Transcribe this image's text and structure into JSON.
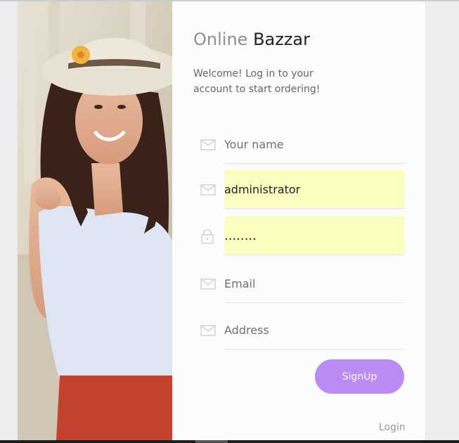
{
  "brand": {
    "part1": "Online",
    "part2": "Bazzar"
  },
  "welcome": "Welcome! Log in to your account to start ordering!",
  "fields": {
    "name": {
      "placeholder": "Your name",
      "value": "",
      "icon": "envelope-icon"
    },
    "username": {
      "placeholder": "",
      "value": "administrator",
      "icon": "envelope-icon"
    },
    "password": {
      "placeholder": "",
      "value": "........",
      "icon": "lock-icon"
    },
    "email": {
      "placeholder": "Email",
      "value": "",
      "icon": "envelope-icon"
    },
    "address": {
      "placeholder": "Address",
      "value": "",
      "icon": "envelope-icon"
    }
  },
  "buttons": {
    "signup": "SignUp",
    "login": "Login"
  },
  "colors": {
    "accent": "#b98cf3",
    "autofill": "#fbfdbf",
    "shirt": "#dfe6f3",
    "skirt": "#c4432e"
  }
}
